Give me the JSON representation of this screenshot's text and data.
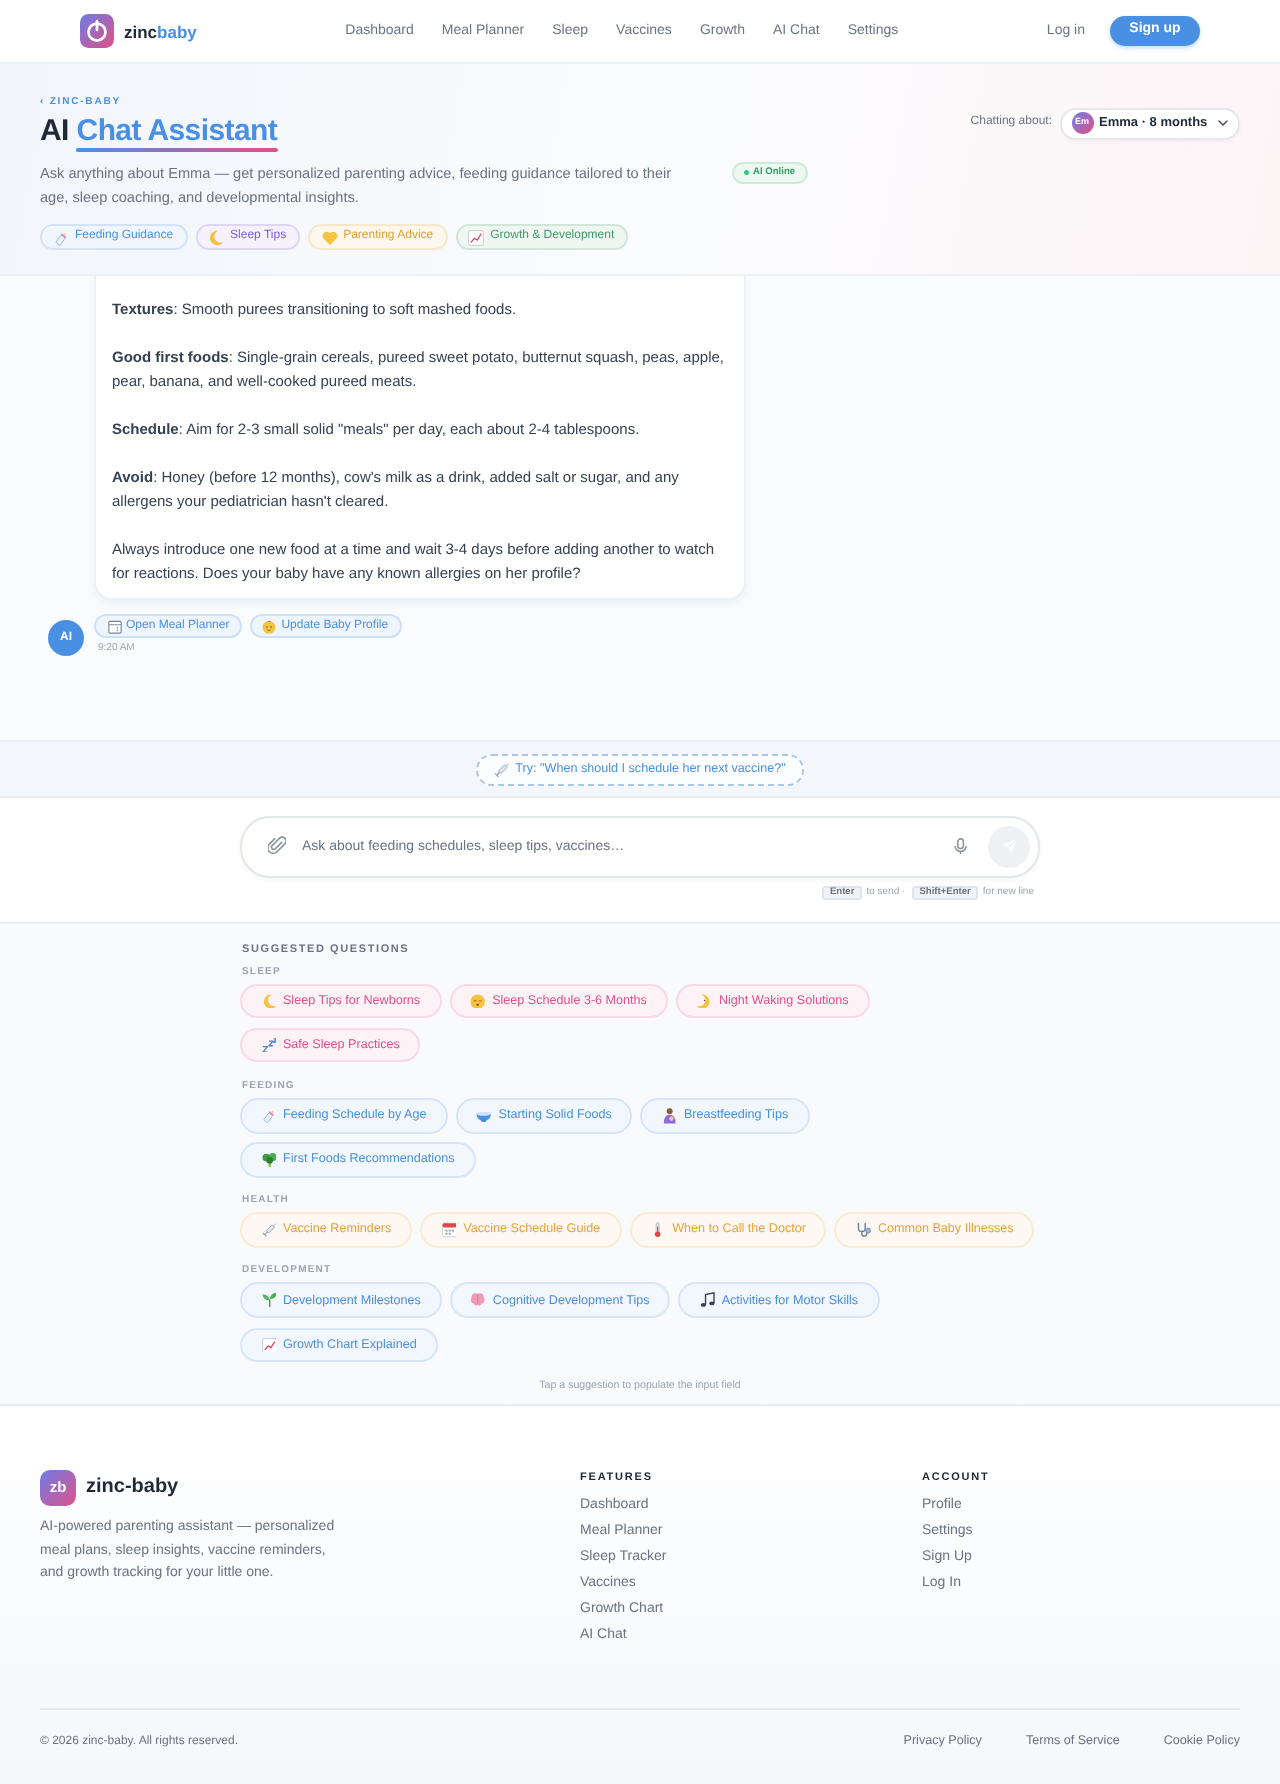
{
  "nav": {
    "brand": {
      "text": "zinc",
      "accent": "baby"
    },
    "links": [
      "Dashboard",
      "Meal Planner",
      "Sleep",
      "Vaccines",
      "Growth",
      "AI Chat",
      "Settings"
    ],
    "login": "Log in",
    "signup": "Sign up"
  },
  "hero": {
    "eyebrow": "‹ ZINC-BABY",
    "title": {
      "text": "AI",
      "highlight": "Chat Assistant"
    },
    "description": "Ask anything about Emma — get personalized parenting advice, feeding guidance tailored to their age, sleep coaching, and developmental insights.",
    "status": "AI Online",
    "tags": [
      {
        "label": "Feeding Guidance",
        "color": "#4a90e2"
      },
      {
        "label": "Sleep Tips",
        "color": "#7c5cd6"
      },
      {
        "label": "Parenting Advice",
        "color": "#e0a030"
      },
      {
        "label": "Growth & Development",
        "color": "#3f9a68"
      }
    ],
    "context": {
      "label": "Chatting about:",
      "avatar": "Em",
      "name": "Emma · 8 months"
    }
  },
  "chat": {
    "paragraphs": [
      "**Textures**: Smooth purees transitioning to soft mashed foods.",
      "**Good first foods**: Single-grain cereals, pureed sweet potato, butternut squash, peas, apple, pear, banana, and well-cooked pureed meats.",
      "**Schedule**: Aim for 2-3 small solid \"meals\" per day, each about 2-4 tablespoons.",
      "**Avoid**: Honey (before 12 months), cow's milk as a drink, added salt or sugar, and any allergens your pediatrician hasn't cleared.",
      "Always introduce one new food at a time and wait 3-4 days before adding another to watch for reactions. Does your baby have any known allergies on her profile?"
    ],
    "avatar": "AI",
    "actions": [
      "Open Meal Planner",
      "Update Baby Profile"
    ],
    "time": "9:20 AM"
  },
  "try_suggestion": "Try: \"When should I schedule her next vaccine?\"",
  "composer": {
    "placeholder": "Ask about feeding schedules, sleep tips, vaccines…",
    "hints": [
      {
        "key": "Enter",
        "text": "to send ·"
      },
      {
        "key": "Shift+Enter",
        "text": "for new line"
      }
    ]
  },
  "suggestions": {
    "title": "SUGGESTED QUESTIONS",
    "groups": [
      {
        "label": "SLEEP",
        "color": "#e0508a",
        "items": [
          "Sleep Tips for Newborns",
          "Sleep Schedule 3-6 Months",
          "Night Waking Solutions",
          "Safe Sleep Practices"
        ]
      },
      {
        "label": "FEEDING",
        "color": "#4a8fdc",
        "items": [
          "Feeding Schedule by Age",
          "Starting Solid Foods",
          "Breastfeeding Tips",
          "First Foods Recommendations"
        ]
      },
      {
        "label": "HEALTH",
        "color": "#e6a23c",
        "items": [
          "Vaccine Reminders",
          "Vaccine Schedule Guide",
          "When to Call the Doctor",
          "Common Baby Illnesses"
        ]
      },
      {
        "label": "DEVELOPMENT",
        "color": "#4a8fdc",
        "items": [
          "Development Milestones",
          "Cognitive Development Tips",
          "Activities for Motor Skills",
          "Growth Chart Explained"
        ]
      }
    ],
    "footnote": "Tap a suggestion to populate the input field"
  },
  "footer": {
    "brand": {
      "badge": "zb",
      "name": "zinc-baby"
    },
    "description": "AI-powered parenting assistant — personalized meal plans, sleep insights, vaccine reminders, and growth tracking for your little one.",
    "columns": [
      {
        "title": "FEATURES",
        "links": [
          "Dashboard",
          "Meal Planner",
          "Sleep Tracker",
          "Vaccines",
          "Growth Chart",
          "AI Chat"
        ]
      },
      {
        "title": "ACCOUNT",
        "links": [
          "Profile",
          "Settings",
          "Sign Up",
          "Log In"
        ]
      }
    ],
    "copyright": "© 2026 zinc-baby. All rights reserved.",
    "legal_links": [
      "Privacy Policy",
      "Terms of Service",
      "Cookie Policy"
    ]
  }
}
